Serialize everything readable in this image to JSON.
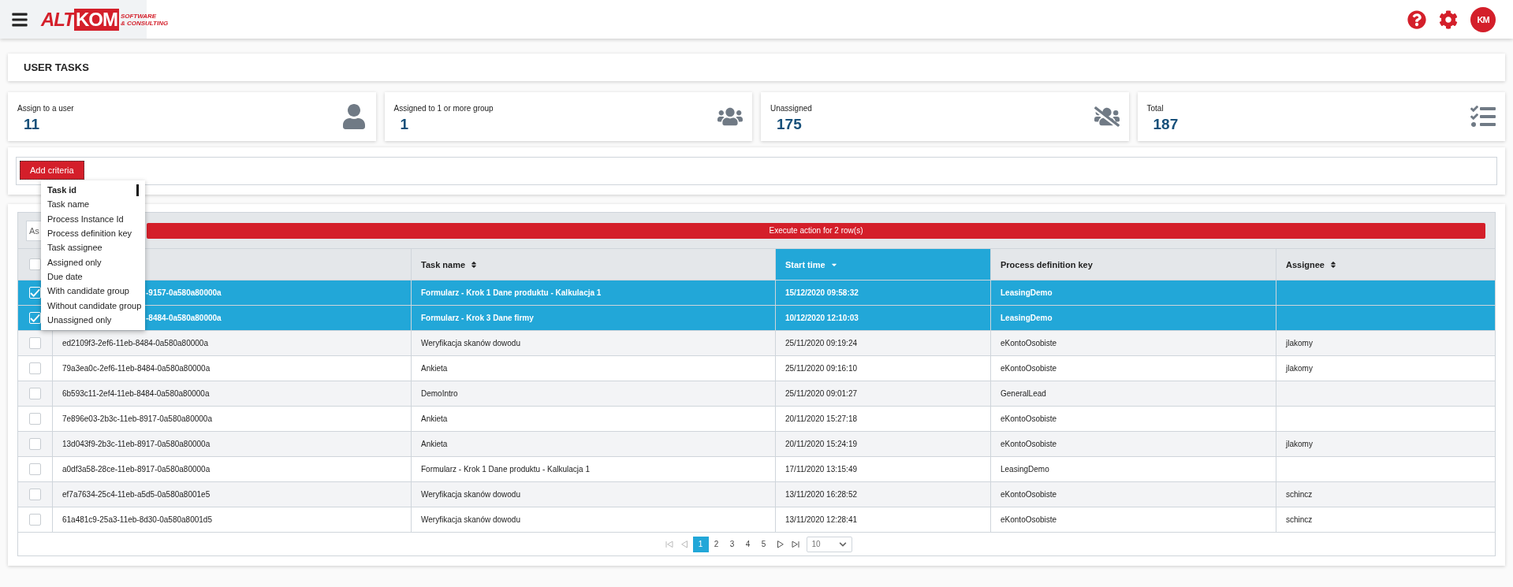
{
  "header": {
    "logo": {
      "prefix": "ALT",
      "boxed": "KOM",
      "tagline_1": "SOFTWARE",
      "tagline_2": "& CONSULTING"
    },
    "avatar": "KM"
  },
  "page_title": "USER TASKS",
  "cards": [
    {
      "kind": "user",
      "label": "Assign to a user",
      "value": "11"
    },
    {
      "kind": "group",
      "label": "Assigned to 1 or more group",
      "value": "1"
    },
    {
      "kind": "unassigned",
      "label": "Unassigned",
      "value": "175"
    },
    {
      "kind": "total",
      "label": "Total",
      "value": "187"
    }
  ],
  "criteria": {
    "button": "Add criteria",
    "menu": [
      {
        "label": "Task id",
        "selected": true
      },
      {
        "label": "Task name",
        "selected": false
      },
      {
        "label": "Process Instance Id",
        "selected": false
      },
      {
        "label": "Process definition key",
        "selected": false
      },
      {
        "label": "Task assignee",
        "selected": false
      },
      {
        "label": "Assigned only",
        "selected": false
      },
      {
        "label": "Due date",
        "selected": false
      },
      {
        "label": "With candidate group",
        "selected": false
      },
      {
        "label": "Without candidate group",
        "selected": false
      },
      {
        "label": "Unassigned only",
        "selected": false
      }
    ]
  },
  "table": {
    "action_select": "As",
    "action_button": "Execute action for 2 row(s)",
    "select_all_checked": false,
    "columns": [
      {},
      {
        "label": "Task name",
        "sortable": true,
        "sorted": false
      },
      {
        "label": "Start time",
        "sorted": true
      },
      {
        "label": "Process definition key",
        "sortable": false,
        "sorted": false
      },
      {
        "label": "Assignee",
        "sortable": true,
        "sorted": false
      }
    ],
    "rows": [
      {
        "selected": true,
        "id": "-9157-0a580a80000a",
        "name": "Formularz - Krok 1 Dane produktu - Kalkulacja 1",
        "start": "15/12/2020 09:58:32",
        "key": "LeasingDemo"
      },
      {
        "selected": true,
        "id": "-8484-0a580a80000a",
        "name": "Formularz - Krok 3 Dane firmy",
        "start": "10/12/2020 12:10:03",
        "key": "LeasingDemo"
      },
      {
        "selected": false,
        "id": "ed2109f3-2ef6-11eb-8484-0a580a80000a",
        "name": "Weryfikacja skanów dowodu",
        "start": "25/11/2020 09:19:24",
        "key": "eKontoOsobiste",
        "assignee": "jlakomy"
      },
      {
        "selected": false,
        "id": "79a3ea0c-2ef6-11eb-8484-0a580a80000a",
        "name": "Ankieta",
        "start": "25/11/2020 09:16:10",
        "key": "eKontoOsobiste",
        "assignee": "jlakomy"
      },
      {
        "selected": false,
        "id": "6b593c11-2ef4-11eb-8484-0a580a80000a",
        "name": "DemoIntro",
        "start": "25/11/2020 09:01:27",
        "key": "GeneralLead"
      },
      {
        "selected": false,
        "id": "7e896e03-2b3c-11eb-8917-0a580a80000a",
        "name": "Ankieta",
        "start": "20/11/2020 15:27:18",
        "key": "eKontoOsobiste"
      },
      {
        "selected": false,
        "id": "13d043f9-2b3c-11eb-8917-0a580a80000a",
        "name": "Ankieta",
        "start": "20/11/2020 15:24:19",
        "key": "eKontoOsobiste",
        "assignee": "jlakomy"
      },
      {
        "selected": false,
        "id": "a0df3a58-28ce-11eb-8917-0a580a80000a",
        "name": "Formularz - Krok 1 Dane produktu - Kalkulacja 1",
        "start": "17/11/2020 13:15:49",
        "key": "LeasingDemo"
      },
      {
        "selected": false,
        "id": "ef7a7634-25c4-11eb-a5d5-0a580a8001e5",
        "name": "Weryfikacja skanów dowodu",
        "start": "13/11/2020 16:28:52",
        "key": "eKontoOsobiste",
        "assignee": "schincz"
      },
      {
        "selected": false,
        "id": "61a481c9-25a3-11eb-8d30-0a580a8001d5",
        "name": "Weryfikacja skanów dowodu",
        "start": "13/11/2020 12:28:41",
        "key": "eKontoOsobiste",
        "assignee": "schincz"
      }
    ]
  },
  "pagination": {
    "first_disabled": true,
    "prev_disabled": true,
    "pages": [
      {
        "label": "1",
        "selected": true
      },
      {
        "label": "2",
        "selected": false
      },
      {
        "label": "3",
        "selected": false
      },
      {
        "label": "4",
        "selected": false
      },
      {
        "label": "5",
        "selected": false
      }
    ],
    "page_size": "10"
  }
}
